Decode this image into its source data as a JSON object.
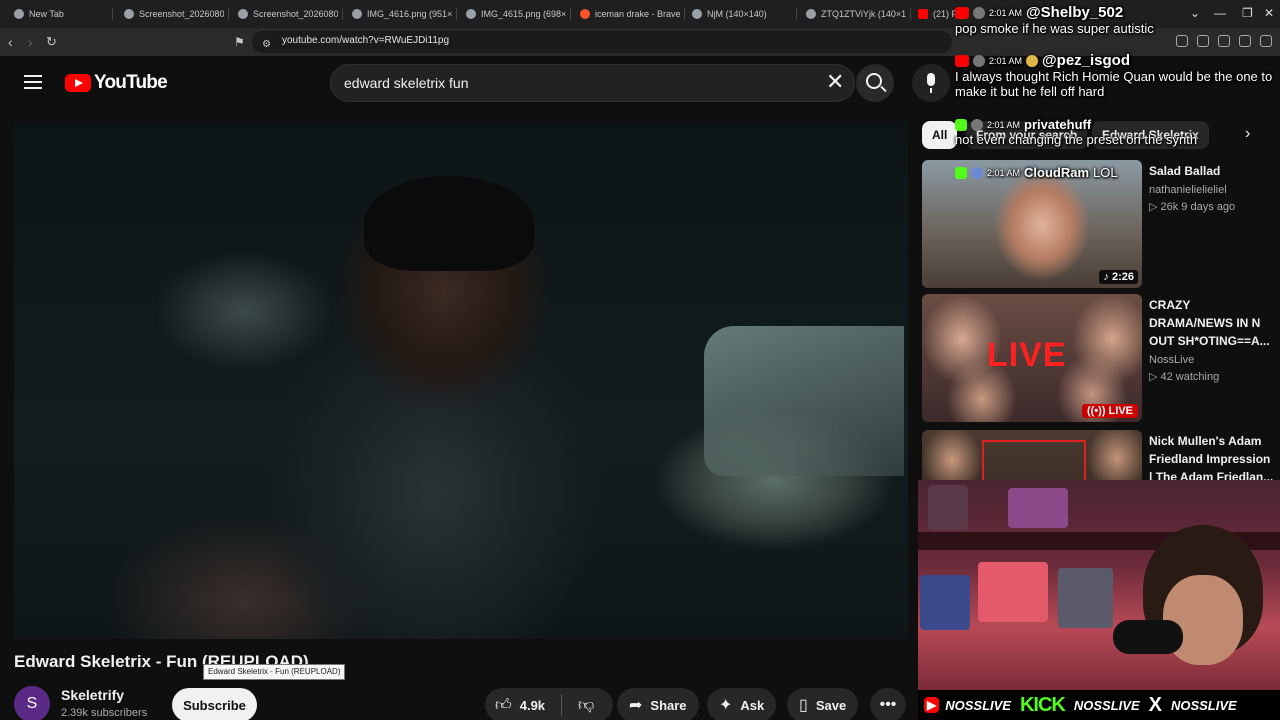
{
  "browser": {
    "tabs": [
      {
        "label": "New Tab",
        "icon": "globe-icon"
      },
      {
        "label": "Screenshot_2026080",
        "icon": "globe-icon"
      },
      {
        "label": "Screenshot_2026080",
        "icon": "globe-icon"
      },
      {
        "label": "IMG_4616.png (951×",
        "icon": "globe-icon"
      },
      {
        "label": "IMG_4615.png (698×5",
        "icon": "globe-icon"
      },
      {
        "label": "iceman drake - Brave",
        "icon": "brave-icon"
      },
      {
        "label": "NjM (140×140)",
        "icon": "globe-icon"
      },
      {
        "label": "ZTQ1ZTViYjk (140×14",
        "icon": "globe-icon"
      },
      {
        "label": "(21) F",
        "icon": "youtube-icon"
      }
    ],
    "new_tab_glyph": "+",
    "url": "youtube.com/watch?v=RWuEJDi11pg"
  },
  "youtube": {
    "logo_text": "YouTube",
    "search_value": "edward skeletrix fun",
    "video": {
      "title": "Edward Skeletrix - Fun (REUPLOAD)",
      "tooltip": "Edward Skeletrix - Fun (REUPLOAD)",
      "channel_initial": "S",
      "channel_name": "Skeletrify",
      "subscribers": "2.39k subscribers",
      "subscribe_label": "Subscribe",
      "likes": "4.9k",
      "share_label": "Share",
      "ask_label": "Ask",
      "save_label": "Save"
    },
    "chips": [
      {
        "label": "All",
        "active": true
      },
      {
        "label": "From your search",
        "active": false
      },
      {
        "label": "Edward Skeletrix",
        "active": false
      }
    ],
    "recommendations": [
      {
        "title": "Salad Ballad",
        "channel": "nathanielielieliel",
        "stats": "▷ 26k  9 days ago",
        "badge": "♪ 2:26"
      },
      {
        "title": "CRAZY DRAMA/NEWS IN N OUT SH*OTING==A...",
        "channel": "NossLive",
        "stats": "▷ 42 watching",
        "badge": "((•)) LIVE",
        "thumb_text": "LIVE"
      },
      {
        "title": "Nick Mullen's Adam Friedland Impression | The Adam Friedlan...",
        "channel": "",
        "stats": "",
        "badge": ""
      }
    ]
  },
  "chat": [
    {
      "platform": "youtube",
      "time": "2:01 AM",
      "user": "@Shelby_502",
      "message": "pop smoke if he was super autistic"
    },
    {
      "platform": "youtube",
      "time": "2:01 AM",
      "user": "@pez_isgod",
      "message": "I always thought Rich Homie Quan would be the one to make it but he fell off hard"
    },
    {
      "platform": "kick",
      "time": "2:01 AM",
      "user": "privatehuff",
      "message": "not even changing the preset on the synth"
    },
    {
      "platform": "kick",
      "time": "2:01 AM",
      "user": "CloudRam",
      "message": "LOL"
    }
  ],
  "stream_bar": {
    "youtube_handle": "NOSSLIVE",
    "kick_logo": "KICK",
    "kick_handle": "NOSSLIVE",
    "x_logo": "X",
    "x_handle": "NOSSLIVE"
  },
  "colors": {
    "youtube_red": "#ff0000",
    "kick_green": "#53fc18",
    "background": "#0f0f0f"
  }
}
